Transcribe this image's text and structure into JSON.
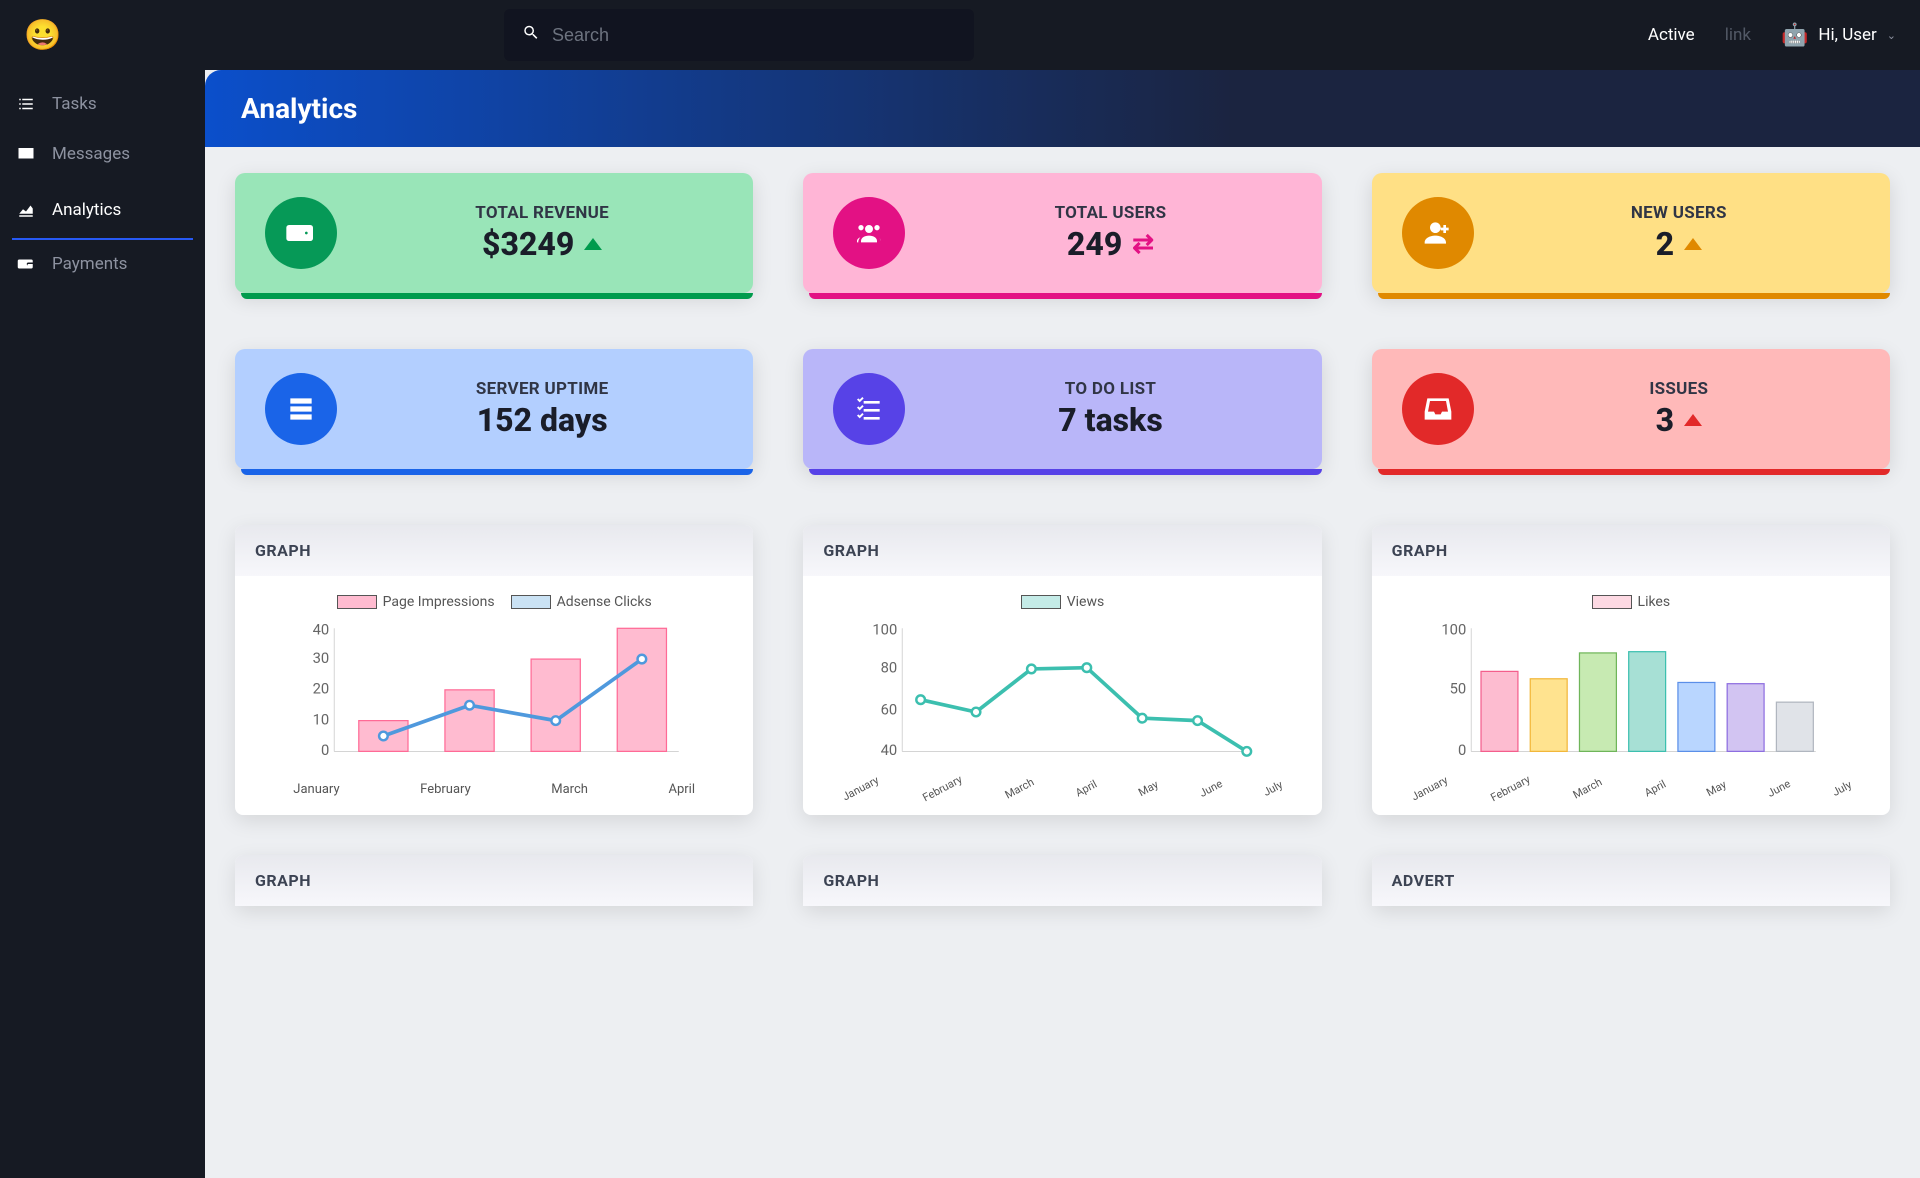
{
  "header": {
    "search_placeholder": "Search",
    "active_label": "Active",
    "link_label": "link",
    "greeting": "Hi, User"
  },
  "sidebar": {
    "items": [
      {
        "label": "Tasks",
        "icon": "tasks-icon",
        "active": false
      },
      {
        "label": "Messages",
        "icon": "envelope-icon",
        "active": false
      },
      {
        "label": "Analytics",
        "icon": "chart-area-icon",
        "active": true
      },
      {
        "label": "Payments",
        "icon": "wallet-icon",
        "active": false
      }
    ]
  },
  "page": {
    "title": "Analytics"
  },
  "stats": [
    {
      "title": "TOTAL REVENUE",
      "value": "$3249",
      "indicator": "up-green",
      "icon": "wallet",
      "color": "green"
    },
    {
      "title": "TOTAL USERS",
      "value": "249",
      "indicator": "swap",
      "icon": "users",
      "color": "pink"
    },
    {
      "title": "NEW USERS",
      "value": "2",
      "indicator": "up-orange",
      "icon": "user-plus",
      "color": "yellow"
    },
    {
      "title": "SERVER UPTIME",
      "value": "152 days",
      "indicator": "",
      "icon": "server",
      "color": "blue"
    },
    {
      "title": "TO DO LIST",
      "value": "7 tasks",
      "indicator": "",
      "icon": "list-check",
      "color": "purple"
    },
    {
      "title": "ISSUES",
      "value": "3",
      "indicator": "up-red",
      "icon": "inbox",
      "color": "red"
    }
  ],
  "graphs": {
    "row1": [
      {
        "title": "GRAPH"
      },
      {
        "title": "GRAPH"
      },
      {
        "title": "GRAPH"
      }
    ],
    "row2": [
      {
        "title": "GRAPH"
      },
      {
        "title": "GRAPH"
      },
      {
        "title": "ADVERT"
      }
    ]
  },
  "chart_data": [
    {
      "type": "bar+line",
      "title": "",
      "categories": [
        "January",
        "February",
        "March",
        "April"
      ],
      "series": [
        {
          "name": "Page Impressions",
          "kind": "bar",
          "color": "#ff9bb8",
          "values": [
            10,
            20,
            30,
            40
          ]
        },
        {
          "name": "Adsense Clicks",
          "kind": "line",
          "color": "#4f99dd",
          "values": [
            5,
            15,
            10,
            30
          ]
        }
      ],
      "ylim": [
        0,
        40
      ],
      "yticks": [
        0,
        10,
        20,
        30,
        40
      ]
    },
    {
      "type": "line",
      "title": "",
      "categories": [
        "January",
        "February",
        "March",
        "April",
        "May",
        "June",
        "July"
      ],
      "series": [
        {
          "name": "Views",
          "kind": "line",
          "color": "#3cbfaf",
          "values": [
            65,
            59,
            80,
            81,
            56,
            55,
            40
          ]
        }
      ],
      "ylim": [
        40,
        100
      ],
      "yticks": [
        40,
        60,
        80,
        100
      ]
    },
    {
      "type": "bar",
      "title": "",
      "categories": [
        "January",
        "February",
        "March",
        "April",
        "May",
        "June",
        "July"
      ],
      "series": [
        {
          "name": "Likes",
          "kind": "bar",
          "color_per_bar": [
            "#fdbcd0",
            "#ffe38f",
            "#c7eab2",
            "#a7e0d5",
            "#b9d6ff",
            "#d2c4f2",
            "#e0e3e8"
          ],
          "border_per_bar": [
            "#f45e8c",
            "#f2b73a",
            "#6fb55a",
            "#3cbfaf",
            "#5b8fe8",
            "#8d6ee0",
            "#b0b6bf"
          ],
          "values": [
            65,
            59,
            80,
            81,
            56,
            55,
            40
          ]
        }
      ],
      "ylim": [
        0,
        100
      ],
      "yticks": [
        0,
        50,
        100
      ]
    }
  ]
}
